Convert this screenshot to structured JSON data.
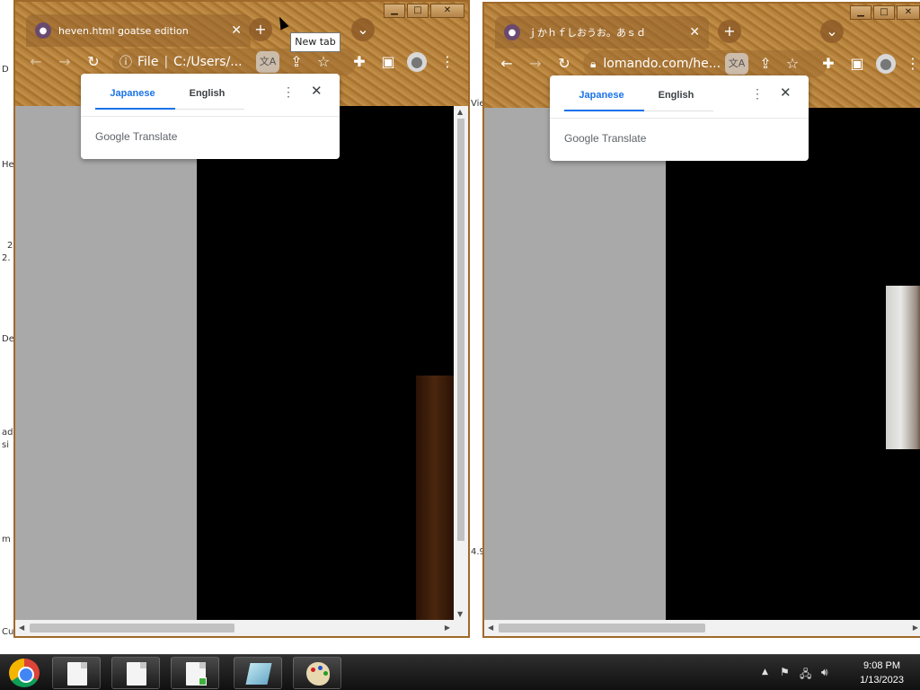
{
  "desktop": {
    "fragments": [
      "D",
      "He",
      "2",
      "2.",
      "De",
      "ad",
      "si",
      "m",
      "Cu",
      "Vie",
      "4.9"
    ]
  },
  "left_window": {
    "tab_title": "heven.html goatse edition",
    "address_scheme": "File",
    "address_text": "C:/Users/...",
    "tooltip": "New tab",
    "translate": {
      "lang_from": "Japanese",
      "lang_to": "English",
      "brand_google": "Google",
      "brand_translate": "Translate"
    }
  },
  "right_window": {
    "tab_title": "ｊかｈｆしおうお。あｓｄ",
    "address_text": "lomando.com/he...",
    "translate": {
      "lang_from": "Japanese",
      "lang_to": "English",
      "brand_google": "Google",
      "brand_translate": "Translate"
    }
  },
  "window_controls": {
    "minimize": "▁",
    "maximize": "□",
    "close": "✕"
  },
  "taskbar": {
    "clock_time": "9:08 PM",
    "clock_date": "1/13/2023"
  }
}
